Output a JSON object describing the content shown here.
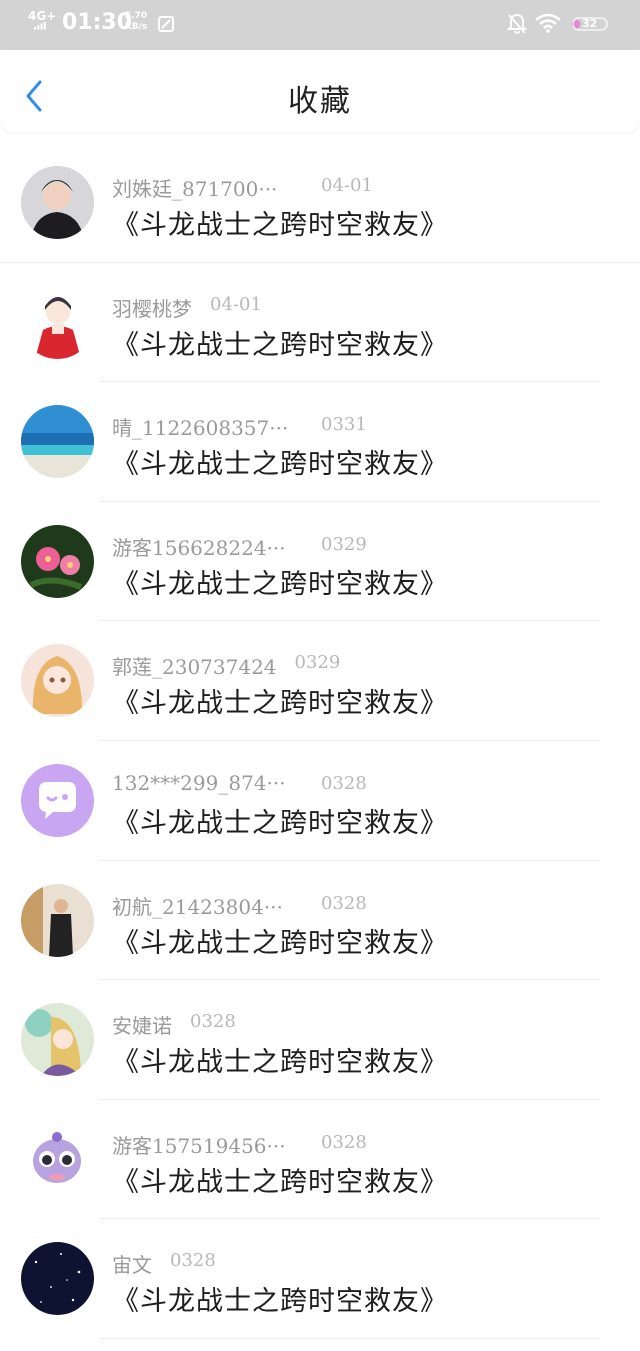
{
  "status_bar": {
    "network": "4G+",
    "time": "01:30",
    "speed_value": "5.70",
    "speed_unit": "KB/s",
    "battery": "32"
  },
  "header": {
    "title": "收藏"
  },
  "items": [
    {
      "username": "刘姝廷_871700···",
      "date": "04-01",
      "title": "《斗龙战士之跨时空救友》",
      "avatar": "boy-portrait-avatar"
    },
    {
      "username": "羽樱桃梦",
      "date": "04-01",
      "title": "《斗龙战士之跨时空救友》",
      "avatar": "anime-girl-red-dress-avatar"
    },
    {
      "username": "晴_1122608357···",
      "date": "0331",
      "title": "《斗龙战士之跨时空救友》",
      "avatar": "beach-ocean-avatar"
    },
    {
      "username": "游客156628224···",
      "date": "0329",
      "title": "《斗龙战士之跨时空救友》",
      "avatar": "pink-flowers-avatar"
    },
    {
      "username": "郭莲_230737424",
      "date": "0329",
      "title": "《斗龙战士之跨时空救友》",
      "avatar": "anime-blonde-girl-avatar"
    },
    {
      "username": "132***299_874···",
      "date": "0328",
      "title": "《斗龙战士之跨时空救友》",
      "avatar": "purple-chat-bubble-avatar"
    },
    {
      "username": "初航_21423804···",
      "date": "0328",
      "title": "《斗龙战士之跨时空救友》",
      "avatar": "man-standing-photo-avatar"
    },
    {
      "username": "安婕诺",
      "date": "0328",
      "title": "《斗龙战士之跨时空救友》",
      "avatar": "anime-girl-green-avatar"
    },
    {
      "username": "游客157519456···",
      "date": "0328",
      "title": "《斗龙战士之跨时空救友》",
      "avatar": "cartoon-purple-creature-avatar"
    },
    {
      "username": "宙文",
      "date": "0328",
      "title": "《斗龙战士之跨时空救友》",
      "avatar": "starry-night-avatar"
    }
  ]
}
